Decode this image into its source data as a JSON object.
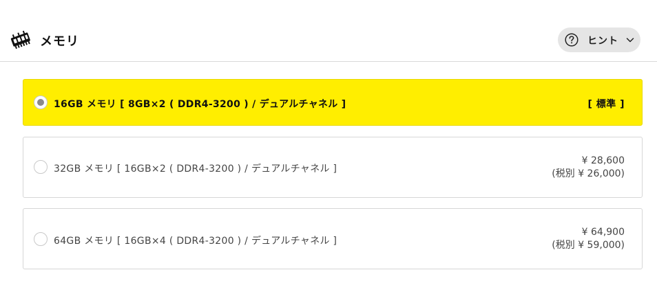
{
  "header": {
    "title": "メモリ",
    "icon": "memory-module-icon",
    "hint_button": {
      "label": "ヒント",
      "icon": "question-circle-icon",
      "chevron": "chevron-down-icon"
    }
  },
  "options": [
    {
      "label": "16GB メモリ [ 8GB×2 ( DDR4-3200 ) / デュアルチャネル ]",
      "badge": "[ 標準 ]",
      "selected": true
    },
    {
      "label": "32GB メモリ [ 16GB×2 ( DDR4-3200 ) / デュアルチャネル ]",
      "price": "¥ 28,600",
      "price_ex_tax": "(税別 ¥ 26,000)",
      "selected": false
    },
    {
      "label": "64GB メモリ [ 16GB×4 ( DDR4-3200 ) / デュアルチャネル ]",
      "price": "¥ 64,900",
      "price_ex_tax": "(税別 ¥ 59,000)",
      "selected": false
    }
  ],
  "colors": {
    "selected_bg": "#ffee00",
    "border": "#d6d6d6",
    "hint_bg": "#e5e5e5"
  }
}
